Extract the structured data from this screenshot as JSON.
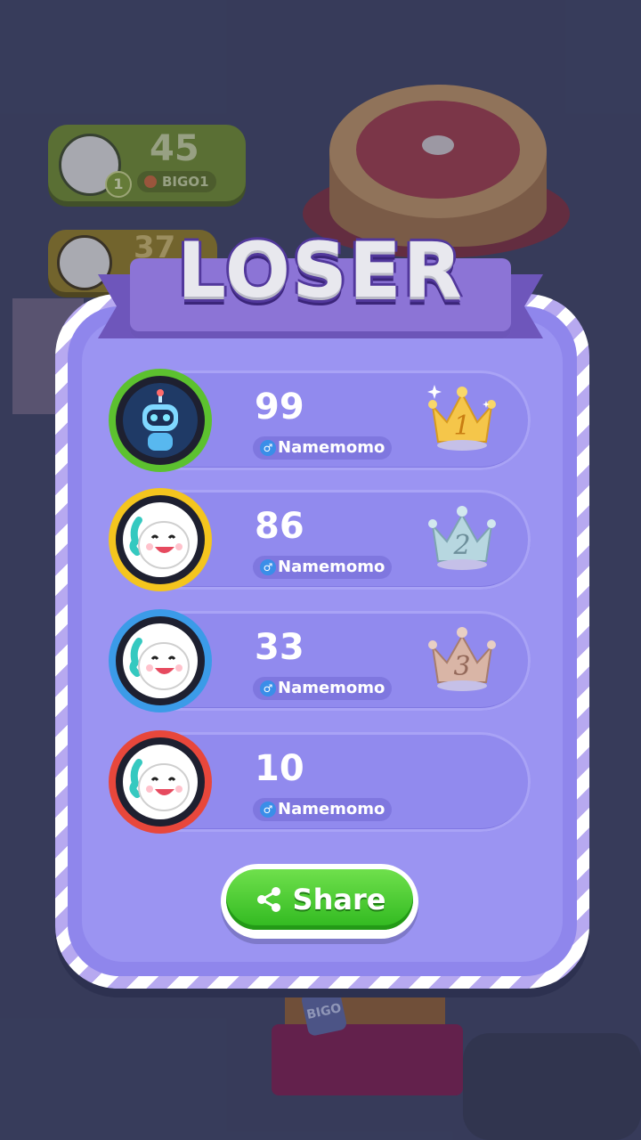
{
  "background": {
    "top_card": {
      "rank": "1",
      "score": "45",
      "name": "BIGO1"
    },
    "second_card": {
      "score": "37"
    },
    "tower_sign": "BIGO"
  },
  "result": {
    "title": "LOSER",
    "players": [
      {
        "score": "99",
        "name": "Namemomo",
        "ring_color": "#5cc12f",
        "crown": "1",
        "avatar": "robot-avatar"
      },
      {
        "score": "86",
        "name": "Namemomo",
        "ring_color": "#f4c51e",
        "crown": "2",
        "avatar": "mascot-avatar"
      },
      {
        "score": "33",
        "name": "Namemomo",
        "ring_color": "#3b9be8",
        "crown": "3",
        "avatar": "mascot-avatar"
      },
      {
        "score": "10",
        "name": "Namemomo",
        "ring_color": "#e8473b",
        "crown": "",
        "avatar": "mascot-avatar"
      }
    ],
    "gender_symbol": "♂",
    "share_label": "Share"
  },
  "colors": {
    "gold_crown": "#f5c64a",
    "silver_crown": "#b7d7e0",
    "bronze_crown": "#d9b5a6",
    "share_green": "#36c022"
  }
}
